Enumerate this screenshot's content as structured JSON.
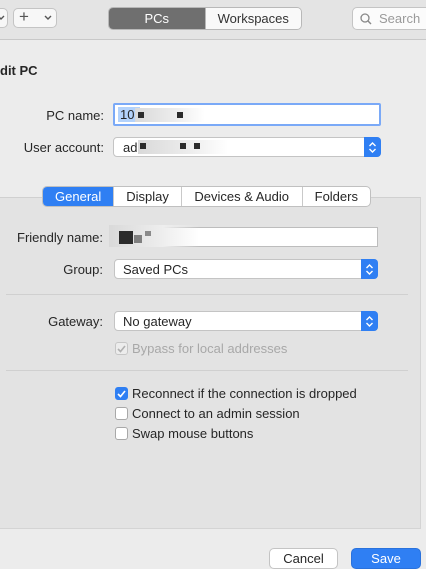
{
  "toolbar": {
    "segment": {
      "pcs": "PCs",
      "workspaces": "Workspaces"
    },
    "search_placeholder": "Search",
    "add_glyph": "+"
  },
  "dialog": {
    "title": "dit PC",
    "pc_name": {
      "label": "PC name:",
      "value": "10."
    },
    "user_account": {
      "label": "User account:",
      "value": "ad"
    },
    "tabs": [
      "General",
      "Display",
      "Devices & Audio",
      "Folders"
    ],
    "friendly_name": {
      "label": "Friendly name:"
    },
    "group": {
      "label": "Group:",
      "value": "Saved PCs"
    },
    "gateway": {
      "label": "Gateway:",
      "value": "No gateway"
    },
    "bypass": {
      "label": "Bypass for local addresses",
      "checked": true
    },
    "reconnect": {
      "label": "Reconnect if the connection is dropped",
      "checked": true
    },
    "admin_session": {
      "label": "Connect to an admin session",
      "checked": false
    },
    "swap_mouse": {
      "label": "Swap mouse buttons",
      "checked": false
    },
    "buttons": {
      "cancel": "Cancel",
      "save": "Save"
    }
  },
  "colors": {
    "accent": "#2f7ff3",
    "segment_active": "#6f6f6f"
  }
}
